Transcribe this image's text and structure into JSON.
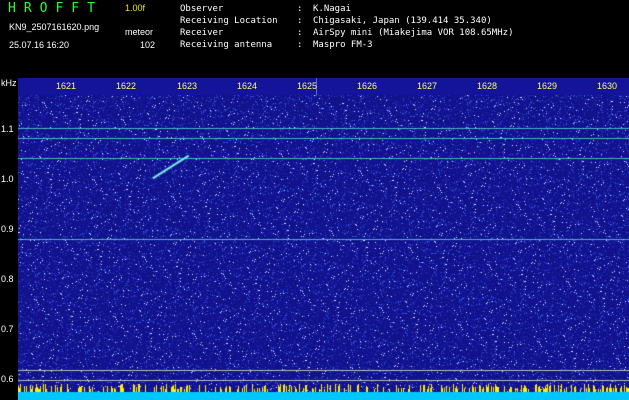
{
  "header": {
    "program": "HROFFT",
    "version": "1.00f",
    "filename": "KN9_2507161620.png",
    "meteor_label": "meteor",
    "datetime": "25.07.16 16:20",
    "count": "102",
    "info": [
      {
        "key": "Observer",
        "value": "K.Nagai"
      },
      {
        "key": "Receiving Location",
        "value": "Chigasaki, Japan (139.414 35.340)"
      },
      {
        "key": "Receiver",
        "value": "AirSpy mini (Miakejima VOR 108.65MHz)"
      },
      {
        "key": "Receiving antenna",
        "value": "Maspro FM-3"
      }
    ],
    "separator": ":"
  },
  "time_axis": {
    "ticks": [
      "1621",
      "1622",
      "1623",
      "1624",
      "1625",
      "1626",
      "1627",
      "1628",
      "1629",
      "1630"
    ]
  },
  "freq_axis": {
    "unit": "kHz",
    "labels": [
      "1.1",
      "1.0",
      "0.9",
      "0.8",
      "0.7",
      "0.6"
    ],
    "value_range": [
      0.58,
      1.16
    ]
  },
  "colors": {
    "background": "#000000",
    "waterfall": "#141488",
    "program_green": "#22ff33",
    "version_yellow": "#e8e800",
    "tick_yellow": "#ffff66",
    "carrier": "#55ddcc"
  },
  "waterfall": {
    "carrier_lines_khz": [
      1.095,
      1.075,
      1.035,
      0.875
    ],
    "meteor_trace": {
      "start_minute": 1622.9,
      "end_minute": 1623.5,
      "start_khz": 0.995,
      "end_khz": 1.04
    }
  }
}
